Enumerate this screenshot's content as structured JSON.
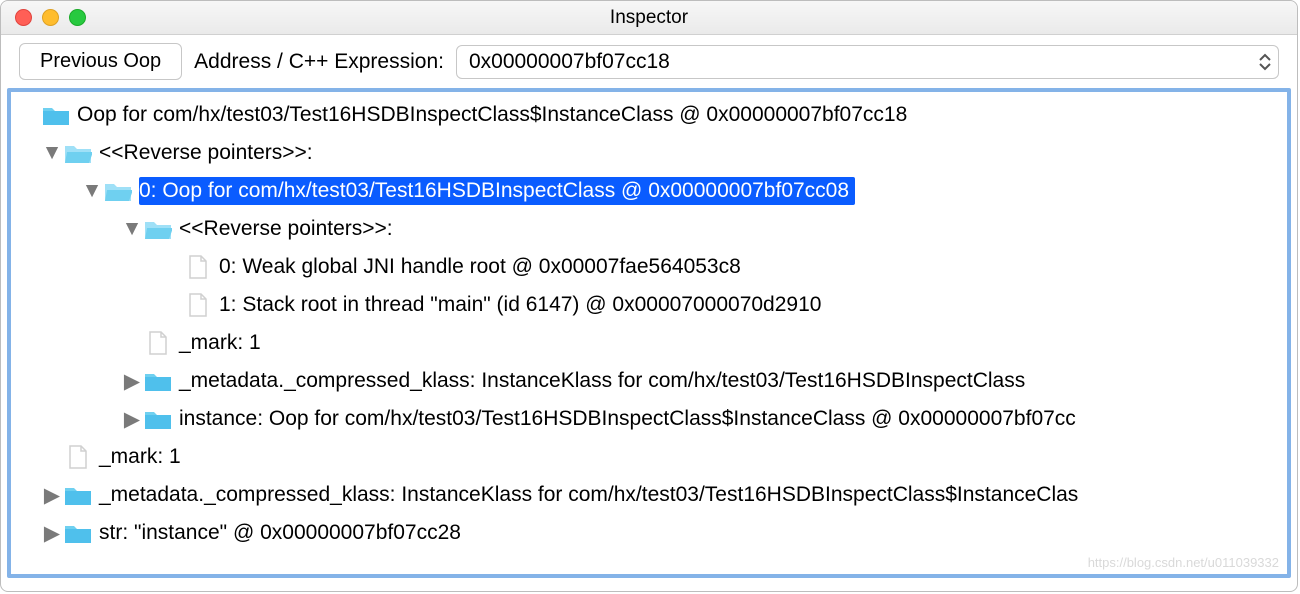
{
  "window": {
    "title": "Inspector"
  },
  "toolbar": {
    "prev_button": "Previous Oop",
    "address_label": "Address / C++ Expression:",
    "address_value": "0x00000007bf07cc18"
  },
  "tree": {
    "root": "Oop for com/hx/test03/Test16HSDBInspectClass$InstanceClass @ 0x00000007bf07cc18",
    "rev_ptrs": "<<Reverse pointers>>:",
    "item0": "0: Oop for com/hx/test03/Test16HSDBInspectClass @ 0x00000007bf07cc08",
    "item0_rev_ptrs": "<<Reverse pointers>>:",
    "item0_leaf0": "0: Weak global JNI handle root @ 0x00007fae564053c8",
    "item0_leaf1": "1: Stack root in thread \"main\" (id 6147) @ 0x00007000070d2910",
    "item0_mark": "_mark: 1",
    "item0_meta": "_metadata._compressed_klass: InstanceKlass for com/hx/test03/Test16HSDBInspectClass",
    "item0_instance": "instance: Oop for com/hx/test03/Test16HSDBInspectClass$InstanceClass @ 0x00000007bf07cc",
    "mark": "_mark: 1",
    "meta": "_metadata._compressed_klass: InstanceKlass for com/hx/test03/Test16HSDBInspectClass$InstanceClas",
    "str": "str: \"instance\" @ 0x00000007bf07cc28"
  },
  "watermark": "https://blog.csdn.net/u011039332"
}
